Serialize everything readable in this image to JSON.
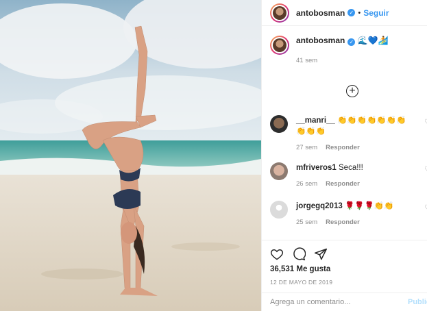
{
  "post": {
    "author": "antobosman",
    "follow_label": "Seguir",
    "dot": "•",
    "caption_emojis": "🌊💙🏄",
    "caption_time": "41 sem",
    "likes": "36,531 Me gusta",
    "date": "12 DE MAYO DE 2019",
    "comment_placeholder": "Agrega un comentario...",
    "publish_label": "Publicar"
  },
  "comments": [
    {
      "user": "__manri__",
      "text": "👏👏👏👏👏👏👏👏👏👏",
      "time": "27 sem",
      "reply": "Responder"
    },
    {
      "user": "mfriveros1",
      "text": "Seca!!!",
      "time": "26 sem",
      "reply": "Responder"
    },
    {
      "user": "jorgegq2013",
      "text": "🌹🌹🌹👏👏",
      "time": "25 sem",
      "reply": "Responder"
    }
  ],
  "colors": {
    "accent": "#3897f0",
    "muted": "#8e8e8e",
    "text": "#262626"
  },
  "icons": [
    "heart-icon",
    "comment-icon",
    "share-icon",
    "add-circle-icon",
    "verified-icon"
  ]
}
